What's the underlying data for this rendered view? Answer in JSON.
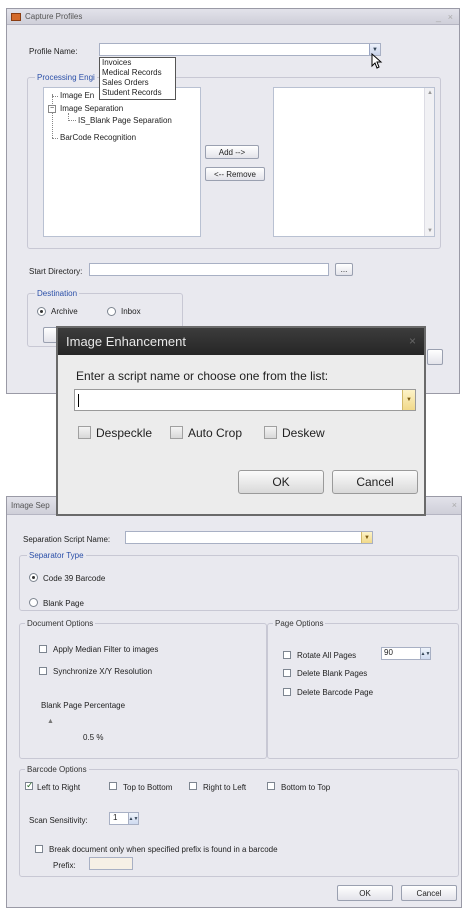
{
  "capture": {
    "title": "Capture Profiles",
    "profile_label": "Profile Name:",
    "profile_value": "",
    "profile_options": [
      "Invoices",
      "Medical Records",
      "Sales Orders",
      "Student Records"
    ],
    "processing_group": "Processing Engi",
    "tree": {
      "image_enh": "Image En",
      "image_sep": "Image Separation",
      "is_blank": "IS_Blank Page Separation",
      "barcode": "BarCode Recognition"
    },
    "add_label": "Add -->",
    "remove_label": "<-- Remove",
    "start_dir_label": "Start Directory:",
    "start_dir_value": "",
    "browse_label": "...",
    "destination_label": "Destination",
    "archive_label": "Archive",
    "inbox_label": "Inbox"
  },
  "enhancement": {
    "title": "Image Enhancement",
    "prompt": "Enter a script name or choose one from the list:",
    "script_value": "",
    "despeckle": "Despeckle",
    "autocrop": "Auto Crop",
    "deskew": "Deskew",
    "ok": "OK",
    "cancel": "Cancel"
  },
  "separation": {
    "title": "Image Sep",
    "script_label": "Separation Script  Name:",
    "script_value": "",
    "sep_type_label": "Separator Type",
    "code39": "Code 39 Barcode",
    "blank_page": "Blank Page",
    "doc_options": "Document Options",
    "median": "Apply Median Filter to images",
    "sync": "Synchronize X/Y Resolution",
    "blank_pct_label": "Blank Page Percentage",
    "blank_pct_value": "0.5 %",
    "page_options": "Page Options",
    "rotate": "Rotate All Pages",
    "rotate_value": "90",
    "delete_blank": "Delete Blank Pages",
    "delete_barcode": "Delete Barcode Page",
    "barcode_options": "Barcode Options",
    "ltr": "Left to Right",
    "ttb": "Top to Bottom",
    "rtl": "Right to Left",
    "btt": "Bottom to Top",
    "scan_label": "Scan Sensitivity:",
    "scan_value": "1",
    "break_label": "Break document only when specified prefix is found in a barcode",
    "prefix_label": "Prefix:",
    "prefix_value": "",
    "ok": "OK",
    "cancel": "Cancel"
  },
  "colors": {
    "accent": "#2a4fa8",
    "window_bg": "#e9e9ef",
    "modal_title": "#262626"
  }
}
